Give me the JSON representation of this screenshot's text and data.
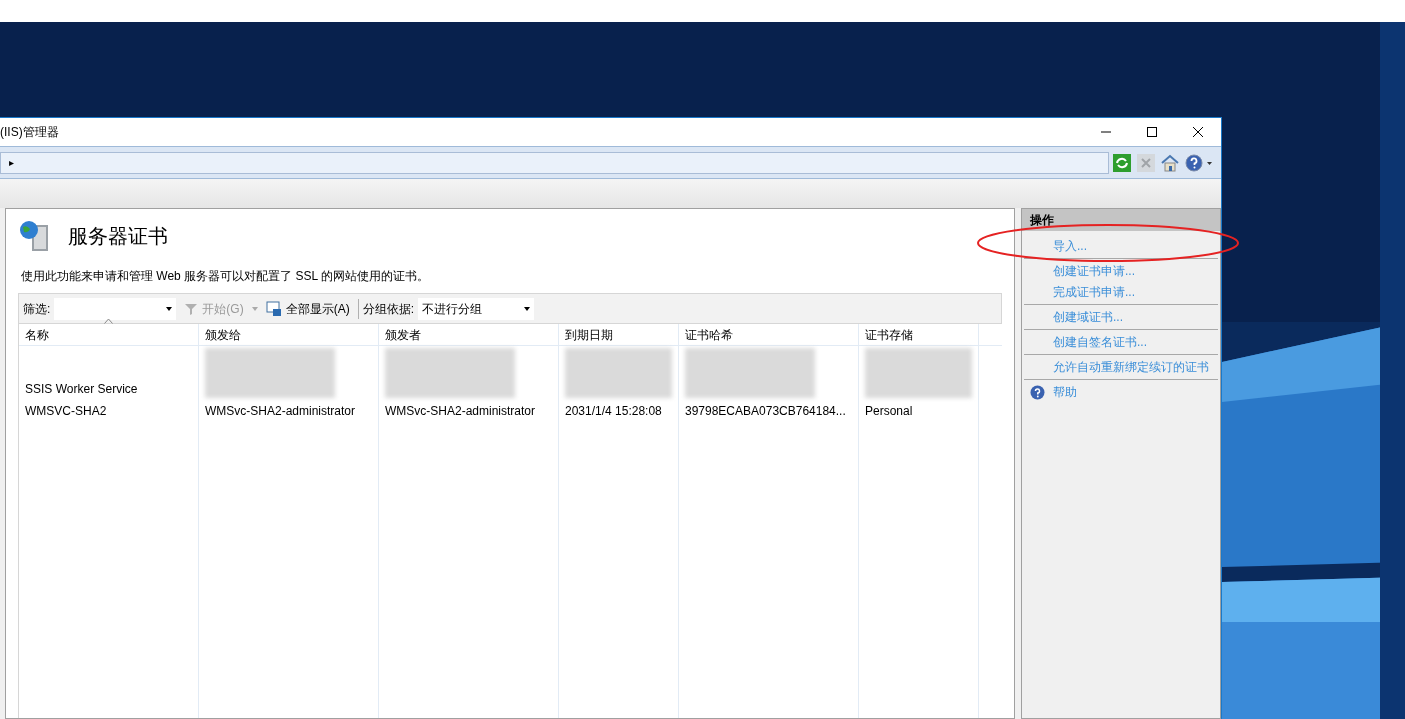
{
  "window": {
    "title": "(IIS)管理器",
    "controls": [
      {
        "kind": "minimize"
      },
      {
        "kind": "maximize"
      },
      {
        "kind": "close"
      }
    ]
  },
  "address_bar": {
    "arrow": "▸"
  },
  "toolbar_icons": [
    {
      "kind": "refresh"
    },
    {
      "kind": "stop"
    },
    {
      "kind": "home"
    },
    {
      "kind": "help"
    }
  ],
  "feature": {
    "title": "服务器证书",
    "description": "使用此功能来申请和管理 Web 服务器可以对配置了 SSL 的网站使用的证书。"
  },
  "filter_bar": {
    "filter_label": "筛选:",
    "start": "开始(G)",
    "show_all": "全部显示(A)",
    "group_label": "分组依据:",
    "group_value": "不进行分组"
  },
  "table": {
    "columns": [
      "名称",
      "颁发给",
      "颁发者",
      "到期日期",
      "证书哈希",
      "证书存储"
    ],
    "rows": [
      {
        "cells": [
          "SSIS Worker Service",
          "",
          "",
          "",
          "",
          ""
        ],
        "redacted": true
      },
      {
        "cells": [
          "WMSVC-SHA2",
          "WMSvc-SHA2-administrator",
          "WMSvc-SHA2-administrator",
          "2031/1/4 15:28:08",
          "39798ECABA073CB764184...",
          "Personal"
        ],
        "redacted": false
      }
    ]
  },
  "actions": {
    "title": "操作",
    "items": [
      {
        "label": "导入...",
        "kind": "link",
        "divider": true
      },
      {
        "label": "创建证书申请...",
        "kind": "link",
        "divider": false
      },
      {
        "label": "完成证书申请...",
        "kind": "link",
        "divider": true
      },
      {
        "label": "创建域证书...",
        "kind": "link",
        "divider": true
      },
      {
        "label": "创建自签名证书...",
        "kind": "link",
        "divider": true
      },
      {
        "label": "允许自动重新绑定续订的证书",
        "kind": "link",
        "divider": true
      },
      {
        "label": "帮助",
        "kind": "help",
        "divider": false
      }
    ]
  }
}
